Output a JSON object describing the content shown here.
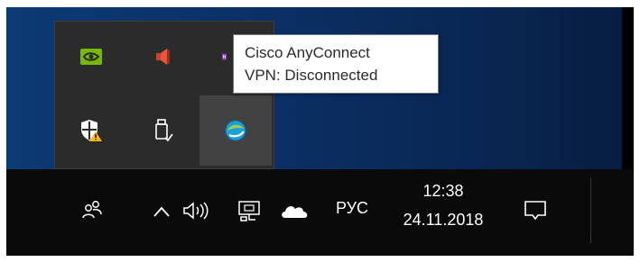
{
  "tooltip": {
    "line1": "Cisco AnyConnect",
    "line2": "VPN: Disconnected"
  },
  "tray_overflow": {
    "icons": [
      {
        "name": "nvidia-icon",
        "color": "#76b900"
      },
      {
        "name": "speaker-muted-icon",
        "color": "#e8553a"
      },
      {
        "name": "onenote-icon",
        "color": "#8a3ab0"
      },
      {
        "name": "windows-security-warning-icon",
        "color": "#ffb900"
      },
      {
        "name": "safely-remove-usb-icon",
        "color": "#ffffff"
      },
      {
        "name": "cisco-anyconnect-icon",
        "color": "#1ba0d7"
      }
    ]
  },
  "taskbar": {
    "people_icon": "people-icon",
    "show_hidden_icon": "chevron-up-icon",
    "volume_icon": "volume-icon",
    "network_icon": "network-wired-icon",
    "onedrive_icon": "onedrive-cloud-icon",
    "language": "РУС",
    "time": "12:38",
    "date": "24.11.2018",
    "action_center_icon": "action-center-icon"
  }
}
